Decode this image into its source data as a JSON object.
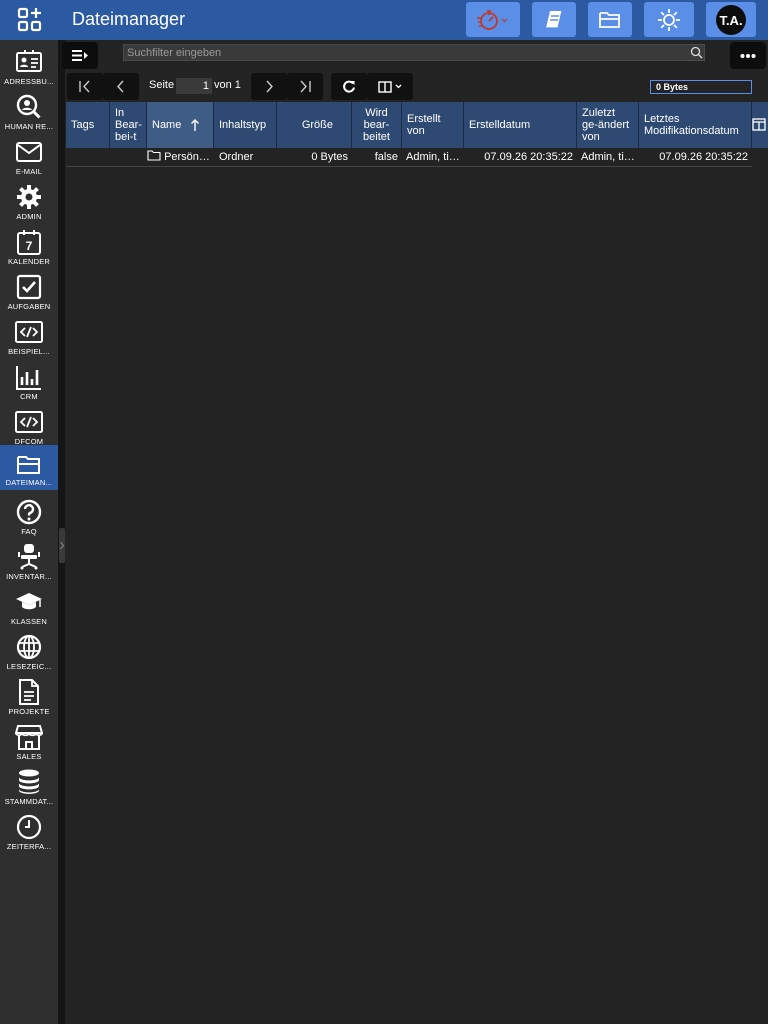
{
  "app": {
    "title": "Dateimanager"
  },
  "user": {
    "initials": "T.A."
  },
  "sidebar": {
    "items": [
      {
        "label": "ADRESSBU...",
        "icon": "address-card-icon"
      },
      {
        "label": "HUMAN RE...",
        "icon": "user-search-icon"
      },
      {
        "label": "E-MAIL",
        "icon": "envelope-icon"
      },
      {
        "label": "ADMIN",
        "icon": "gear-icon"
      },
      {
        "label": "KALENDER",
        "icon": "calendar-icon"
      },
      {
        "label": "AUFGABEN",
        "icon": "checkbox-icon"
      },
      {
        "label": "BEISPIEL...",
        "icon": "code-icon"
      },
      {
        "label": "CRM",
        "icon": "bar-chart-icon"
      },
      {
        "label": "DFCOM",
        "icon": "code-icon"
      },
      {
        "label": "DATEIMAN...",
        "icon": "folder-open-icon"
      },
      {
        "label": "FAQ",
        "icon": "question-icon"
      },
      {
        "label": "INVENTAR...",
        "icon": "office-chair-icon"
      },
      {
        "label": "KLASSEN",
        "icon": "graduation-cap-icon"
      },
      {
        "label": "LESEZEIC...",
        "icon": "globe-icon"
      },
      {
        "label": "PROJEKTE",
        "icon": "document-icon"
      },
      {
        "label": "SALES",
        "icon": "store-icon"
      },
      {
        "label": "STAMMDAT...",
        "icon": "database-icon"
      },
      {
        "label": "ZEITERFA...",
        "icon": "clock-icon"
      }
    ],
    "active_index": 9
  },
  "search": {
    "placeholder": "Suchfilter eingeben"
  },
  "pager": {
    "page_label": "Seite",
    "page_value": "1",
    "of_label": "von 1"
  },
  "storage": {
    "size": "0 Bytes"
  },
  "table": {
    "columns": [
      "Tags",
      "In Bear-bei-t",
      "Name",
      "Inhaltstyp",
      "Größe",
      "Wird bear-beitet",
      "Erstellt von",
      "Erstelldatum",
      "Zuletzt ge-ändert von",
      "Letztes Modifikationsdatum"
    ],
    "sort_column": "Name",
    "rows": [
      {
        "tags": "",
        "in_bearbeitung": "",
        "name": "Persön…",
        "inhaltstyp": "Ordner",
        "groesse": "0 Bytes",
        "wird_bearbeitet": "false",
        "erstellt_von": "Admin, ti…",
        "erstelldatum": "07.09.26 20:35:22",
        "zuletzt_geaendert_von": "Admin, ti…",
        "modifikationsdatum": "07.09.26 20:35:22"
      }
    ]
  },
  "colors": {
    "topbar": "#2b5aa3",
    "button": "#5b8ee6",
    "header": "#2f4a72",
    "background": "#232323",
    "sidebar": "#2f2f2f"
  }
}
